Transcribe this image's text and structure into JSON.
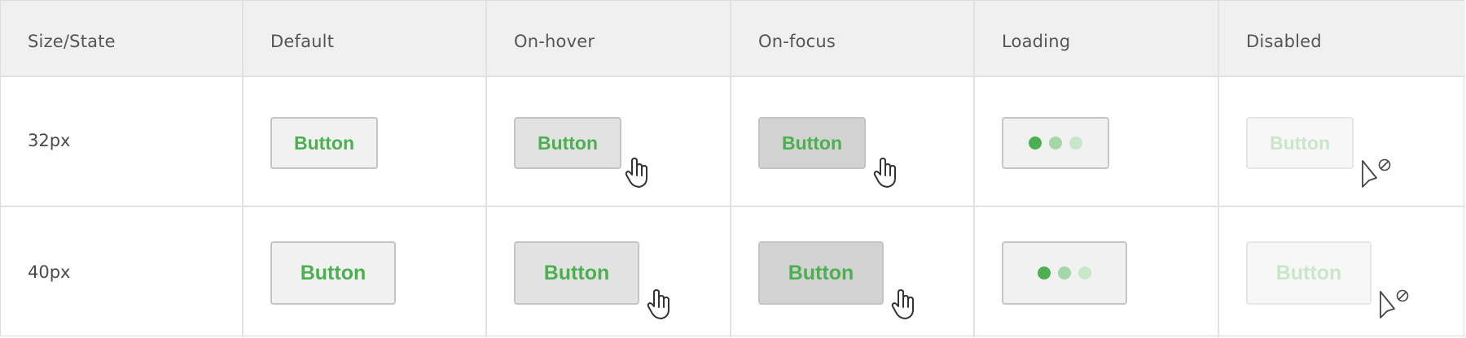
{
  "table": {
    "headers": [
      "Size/State",
      "Default",
      "On-hover",
      "On-focus",
      "Loading",
      "Disabled"
    ],
    "rows": [
      {
        "size": "32px"
      },
      {
        "size": "40px"
      }
    ]
  },
  "button_label": "Button",
  "colors": {
    "accent": "#4caf50",
    "dot_active": "#4caf50",
    "dot_mid": "#a5d6a7",
    "dot_light": "#c8e6c9"
  },
  "icons": {
    "hover": "hand-pointer-icon",
    "focus": "hand-pointer-icon",
    "disabled": "not-allowed-cursor-icon"
  }
}
